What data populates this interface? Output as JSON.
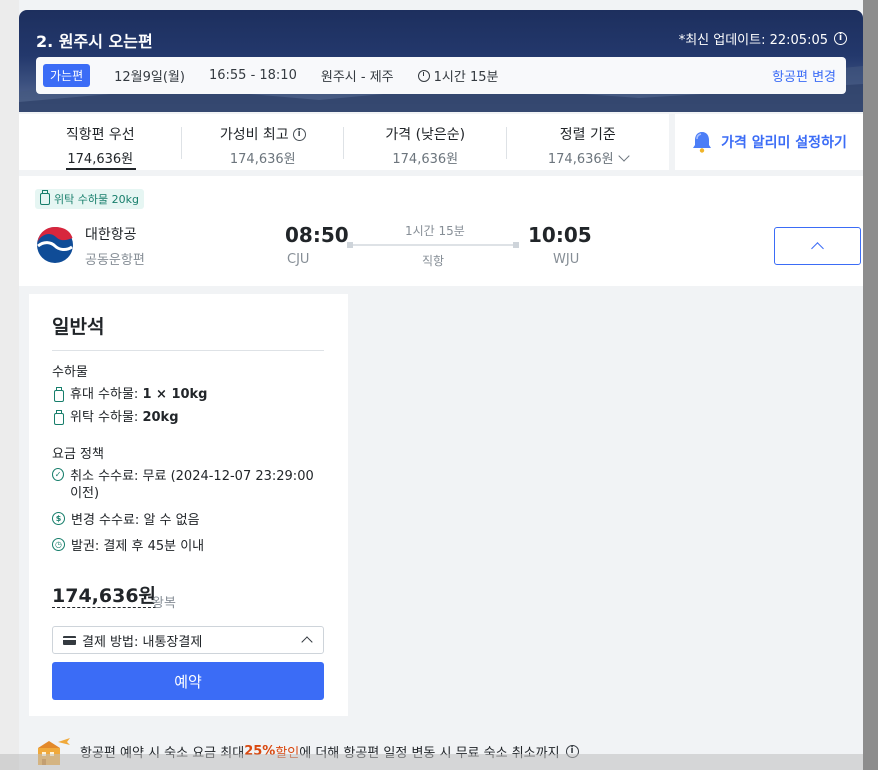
{
  "header": {
    "title": "2. 원주시 오는편",
    "update_label": "*최신 업데이트: 22:05:05"
  },
  "route": {
    "direction_badge": "가는편",
    "date": "12월9일(월)",
    "time": "16:55 - 18:10",
    "route": "원주시 - 제주",
    "duration": "1시간 15분",
    "change_link": "항공편 변경"
  },
  "sort": {
    "items": [
      {
        "label": "직항편 우선",
        "price": "174,636원"
      },
      {
        "label": "가성비 최고",
        "price": "174,636원"
      },
      {
        "label": "가격 (낮은순)",
        "price": "174,636원"
      },
      {
        "label": "정렬 기준",
        "price": "174,636원"
      }
    ],
    "alert_label": "가격 알리미 설정하기"
  },
  "flight": {
    "bag_tag": "위탁 수하물 20kg",
    "airline": "대한항공",
    "codeshare": "공동운항편",
    "dep_time": "08:50",
    "dep_code": "CJU",
    "duration": "1시간 15분",
    "stops": "직항",
    "arr_time": "10:05",
    "arr_code": "WJU"
  },
  "fare": {
    "class": "일반석",
    "baggage_title": "수하물",
    "carry_on_label": "휴대 수하물: ",
    "carry_on_value": "1 × 10kg",
    "checked_label": "위탁 수하물: ",
    "checked_value": "20kg",
    "policy_title": "요금 정책",
    "cancel": "취소 수수료: 무료 (2024-12-07 23:29:00 이전)",
    "change": "변경 수수료: 알 수 없음",
    "ticketing": "발권: 결제 후 45분 이내",
    "price": "174,636원",
    "price_note": "왕복",
    "payment": "결제 방법: 내통장결제",
    "book_label": "예약"
  },
  "promo": {
    "text_a": "항공편 예약 시 숙소 요금 최대 ",
    "highlight": "25%",
    "text_b": " 할인",
    "text_c": "에 더해 항공편 일정 변동 시 무료 숙소 취소까지"
  }
}
